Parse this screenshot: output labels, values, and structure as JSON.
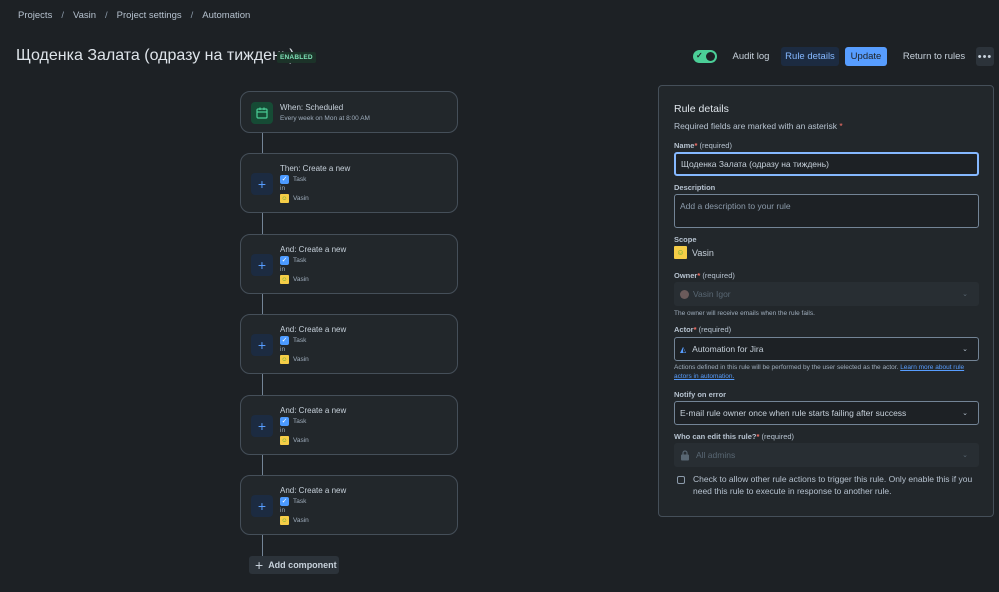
{
  "breadcrumb": [
    "Projects",
    "Vasin",
    "Project settings",
    "Automation"
  ],
  "title": "Щоденка Залата (одразу на тиждень)",
  "status_badge": "ENABLED",
  "header": {
    "audit_log": "Audit log",
    "rule_details": "Rule details",
    "update": "Update",
    "return_to_rules": "Return to rules",
    "more": "•••"
  },
  "flow": {
    "trigger": {
      "title": "When: Scheduled",
      "subtitle": "Every week on Mon at 8:00 AM"
    },
    "actions": [
      {
        "title": "Then: Create a new",
        "issue_type": "Task",
        "in": "in",
        "project": "Vasin"
      },
      {
        "title": "And: Create a new",
        "issue_type": "Task",
        "in": "in",
        "project": "Vasin"
      },
      {
        "title": "And: Create a new",
        "issue_type": "Task",
        "in": "in",
        "project": "Vasin"
      },
      {
        "title": "And: Create a new",
        "issue_type": "Task",
        "in": "in",
        "project": "Vasin"
      },
      {
        "title": "And: Create a new",
        "issue_type": "Task",
        "in": "in",
        "project": "Vasin"
      }
    ],
    "add_component": "Add component"
  },
  "panel": {
    "title": "Rule details",
    "subtitle": "Required fields are marked with an asterisk",
    "required_text": "(required)",
    "name_label": "Name",
    "name_value": "Щоденка Залата (одразу на тиждень)",
    "description_label": "Description",
    "description_placeholder": "Add a description to your rule",
    "scope_label": "Scope",
    "scope_value": "Vasin",
    "owner_label": "Owner",
    "owner_value": "Vasin Igor",
    "owner_help": "The owner will receive emails when the rule fails.",
    "actor_label": "Actor",
    "actor_value": "Automation for Jira",
    "actor_help": "Actions defined in this rule will be performed by the user selected as the actor.",
    "actor_link": "Learn more about rule actors in automation.",
    "notify_label": "Notify on error",
    "notify_value": "E-mail rule owner once when rule starts failing after success",
    "edit_label": "Who can edit this rule?",
    "edit_value": "All admins",
    "checkbox_text": "Check to allow other rule actions to trigger this rule. Only enable this if you need this rule to execute in response to another rule."
  },
  "colors": {
    "background": "#1d2125",
    "accent": "#579dff",
    "enabled": "#4bce97"
  }
}
